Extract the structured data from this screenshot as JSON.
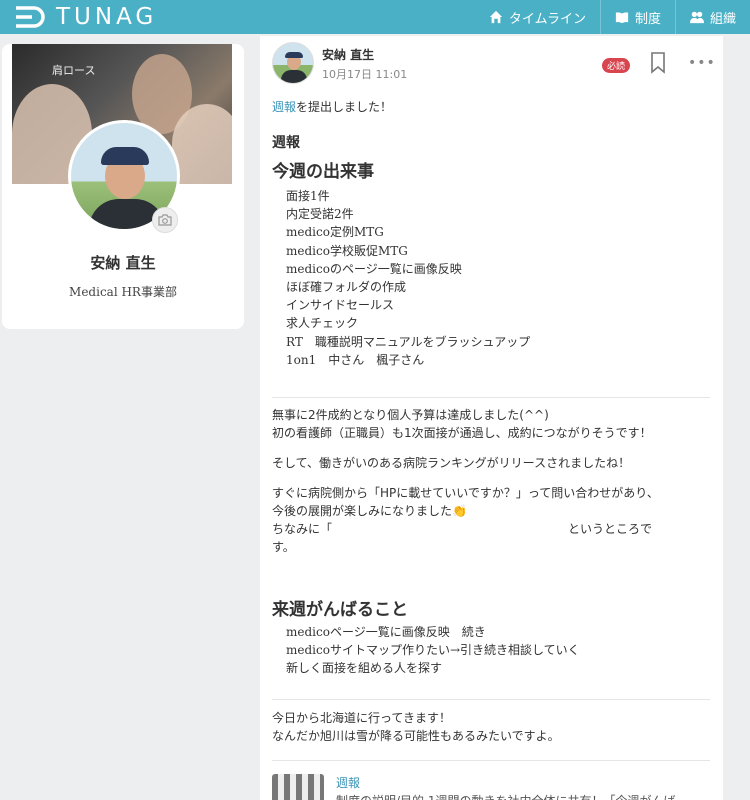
{
  "header": {
    "logo_text": "TUNAG",
    "nav": [
      {
        "label": "タイムライン",
        "icon": "home-icon"
      },
      {
        "label": "制度",
        "icon": "book-icon"
      },
      {
        "label": "組織",
        "icon": "people-icon"
      }
    ],
    "bg_color": "#4ab0c6"
  },
  "profile": {
    "name": "安納 直生",
    "department": "Medical HR事業部",
    "cover_sign": "肩ロース"
  },
  "post": {
    "author": "安納 直生",
    "time": "10月17日 11:01",
    "badge": "必読",
    "intro_link": "週報",
    "intro_rest": "を提出しました！",
    "heading_small": "週報",
    "section1_title": "今週の出来事",
    "section1_items": [
      "面接1件",
      "内定受諾2件",
      "medico定例MTG",
      "medico学校販促MTG",
      "medicoのページ一覧に画像反映",
      "ほぼ確フォルダの作成",
      "インサイドセールス",
      "求人チェック",
      "RT　職種説明マニュアルをブラッシュアップ",
      "1on1　中さん　楓子さん"
    ],
    "para1_line1": "無事に2件成約となり個人予算は達成しました(^^)",
    "para1_line2": "初の看護師（正職員）も1次面接が通過し、成約につながりそうです！",
    "para2": "そして、働きがいのある病院ランキングがリリースされましたね！",
    "para3_line1": "すぐに病院側から「HPに載せていいですか？」って問い合わせがあり、",
    "para3_line2": "今後の展開が楽しみになりました",
    "para3_emoji": "👏",
    "para3_line3_start": "ちなみに「",
    "para3_line3_end": "というところで",
    "para3_line4": "す。",
    "section2_title": "来週がんばること",
    "section2_items": [
      "medicoページ一覧に画像反映　続き",
      "medicoサイトマップ作りたい→引き続き相談していく",
      "新しく面接を組める人を探す"
    ],
    "para4_line1": "今日から北海道に行ってきます！",
    "para4_line2": "なんだか旭川は雪が降る可能性もあるみたいですよ。"
  },
  "related": {
    "title": "週報",
    "excerpt": "制度の説明/目的 1週間の動きを社内全体に共有！「今週がんば"
  },
  "colors": {
    "accent": "#3b93b8",
    "badge": "#d9454e"
  }
}
